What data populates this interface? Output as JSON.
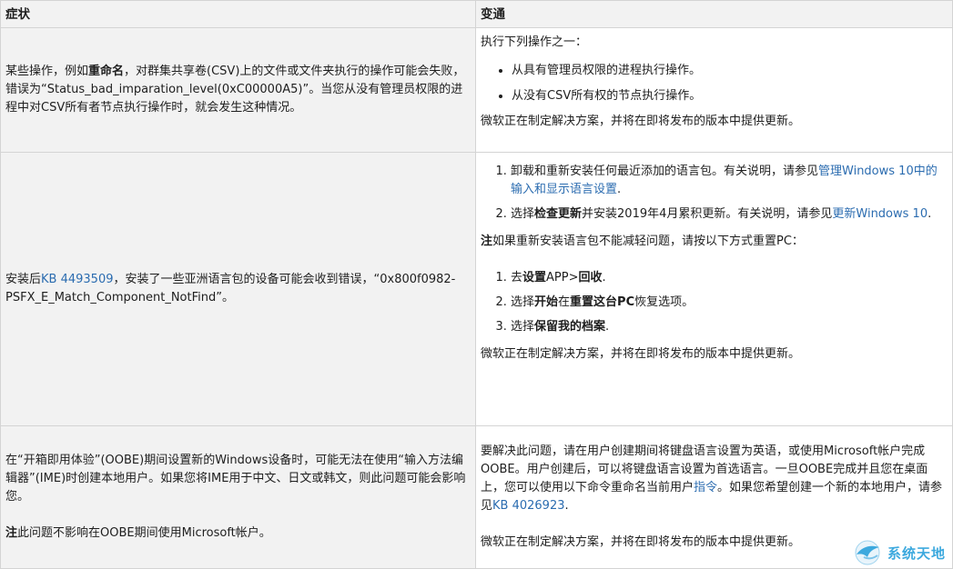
{
  "header": {
    "symptom": "症状",
    "workaround": "变通"
  },
  "rows": [
    {
      "symptom": [
        {
          "t": "某些操作，例如"
        },
        {
          "t": "重命名",
          "b": true
        },
        {
          "t": "，对群集共享卷(CSV)上的文件或文件夹执行的操作可能会失败，错误为“Status_bad_imparation_level(0xC00000A5)”。当您从没有管理员权限的进程中对CSV所有者节点执行操作时，就会发生这种情况。"
        }
      ],
      "intro": "执行下列操作之一：",
      "bullets": [
        "从具有管理员权限的进程执行操作。",
        "从没有CSV所有权的节点执行操作。"
      ],
      "footer": "微软正在制定解决方案，并将在即将发布的版本中提供更新。"
    },
    {
      "symptom_pre": "安装后",
      "symptom_link": "KB 4493509",
      "symptom_post": "，安装了一些亚洲语言包的设备可能会收到错误，“0x800f0982-PSFX_E_Match_Component_NotFind”。",
      "list1": [
        [
          {
            "t": "卸载和重新安装任何最近添加的语言包。有关说明，请参见"
          },
          {
            "t": "管理Windows 10中的输入和显示语言设置",
            "l": true
          },
          {
            "t": "."
          }
        ],
        [
          {
            "t": "选择"
          },
          {
            "t": "检查更新",
            "b": true
          },
          {
            "t": "并安装2019年4月累积更新。有关说明，请参见"
          },
          {
            "t": "更新Windows 10",
            "l": true
          },
          {
            "t": "."
          }
        ]
      ],
      "note_label": "注",
      "note_text": "如果重新安装语言包不能减轻问题，请按以下方式重置PC：",
      "list2": [
        [
          {
            "t": "去"
          },
          {
            "t": "设置",
            "b": true
          },
          {
            "t": "APP>"
          },
          {
            "t": "回收",
            "b": true
          },
          {
            "t": "."
          }
        ],
        [
          {
            "t": "选择"
          },
          {
            "t": "开始",
            "b": true
          },
          {
            "t": "在"
          },
          {
            "t": "重置这台PC",
            "b": true
          },
          {
            "t": "恢复选项。"
          }
        ],
        [
          {
            "t": "选择"
          },
          {
            "t": "保留我的档案",
            "b": true
          },
          {
            "t": "."
          }
        ]
      ],
      "footer": "微软正在制定解决方案，并将在即将发布的版本中提供更新。"
    },
    {
      "symptom": "在“开箱即用体验”(OOBE)期间设置新的Windows设备时，可能无法在使用“输入方法编辑器”(IME)时创建本地用户。如果您将IME用于中文、日文或韩文，则此问题可能会影响您。",
      "note_label": "注",
      "note_text": "此问题不影响在OOBE期间使用Microsoft帐户。",
      "workaround": [
        {
          "t": "要解决此问题，请在用户创建期间将键盘语言设置为英语，或使用Microsoft帐户完成OOBE。用户创建后，可以将键盘语言设置为首选语言。一旦OOBE完成并且您在桌面上，您可以使用以下命令重命名当前用户"
        },
        {
          "t": "指令",
          "l": true
        },
        {
          "t": "。如果您希望创建一个新的本地用户，请参见"
        },
        {
          "t": "KB 4026923",
          "l": true
        },
        {
          "t": "."
        }
      ],
      "footer": "微软正在制定解决方案，并将在即将发布的版本中提供更新。"
    }
  ],
  "watermark": {
    "text": "系统天地",
    "icon": "bird-logo-icon"
  },
  "colors": {
    "link": "#2b6cb0",
    "header_bg": "#f2f2f2",
    "border": "#d4d4d4"
  }
}
